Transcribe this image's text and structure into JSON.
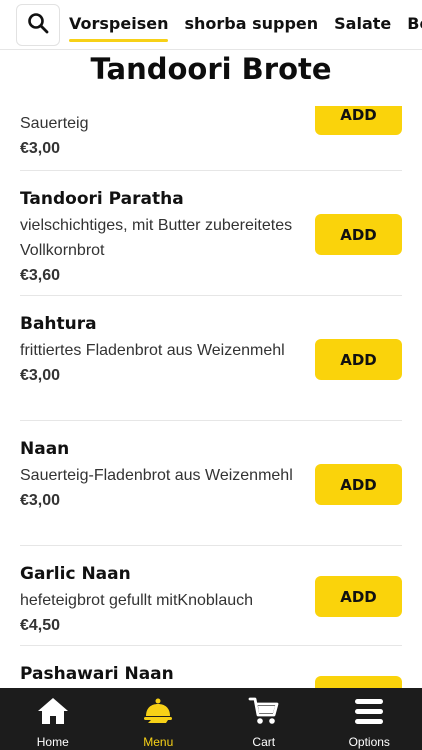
{
  "header": {
    "search_icon": "search-icon",
    "tabs": [
      {
        "label": "Vorspeisen",
        "active": true
      },
      {
        "label": "shorba suppen",
        "active": false
      },
      {
        "label": "Salate",
        "active": false
      },
      {
        "label": "Beil",
        "active": false
      }
    ],
    "accent_color": "#f7d117"
  },
  "section": {
    "title": "Tandoori Brote"
  },
  "items": [
    {
      "name": "",
      "desc": "Sauerteig",
      "price": "€3,00",
      "button": "ADD"
    },
    {
      "name": "Tandoori Paratha",
      "desc": "vielschichtiges, mit Butter zubereitetes Vollkornbrot",
      "price": "€3,60",
      "button": "ADD"
    },
    {
      "name": "Bahtura",
      "desc": "frittiertes Fladenbrot aus Weizenmehl",
      "price": "€3,00",
      "button": "ADD"
    },
    {
      "name": "Naan",
      "desc": "Sauerteig-Fladenbrot aus Weizenmehl",
      "price": "€3,00",
      "button": "ADD"
    },
    {
      "name": "Garlic Naan",
      "desc": "hefeteigbrot gefullt mitKnoblauch",
      "price": "€4,50",
      "button": "ADD"
    },
    {
      "name": "Pashawari Naan",
      "desc": "",
      "price": "",
      "button": "ADD"
    }
  ],
  "bottom_nav": [
    {
      "label": "Home",
      "icon": "home-icon",
      "active": false
    },
    {
      "label": "Menu",
      "icon": "menu-cloche-icon",
      "active": true
    },
    {
      "label": "Cart",
      "icon": "cart-icon",
      "active": false
    },
    {
      "label": "Options",
      "icon": "hamburger-icon",
      "active": false
    }
  ],
  "button_color": "#fad30b"
}
